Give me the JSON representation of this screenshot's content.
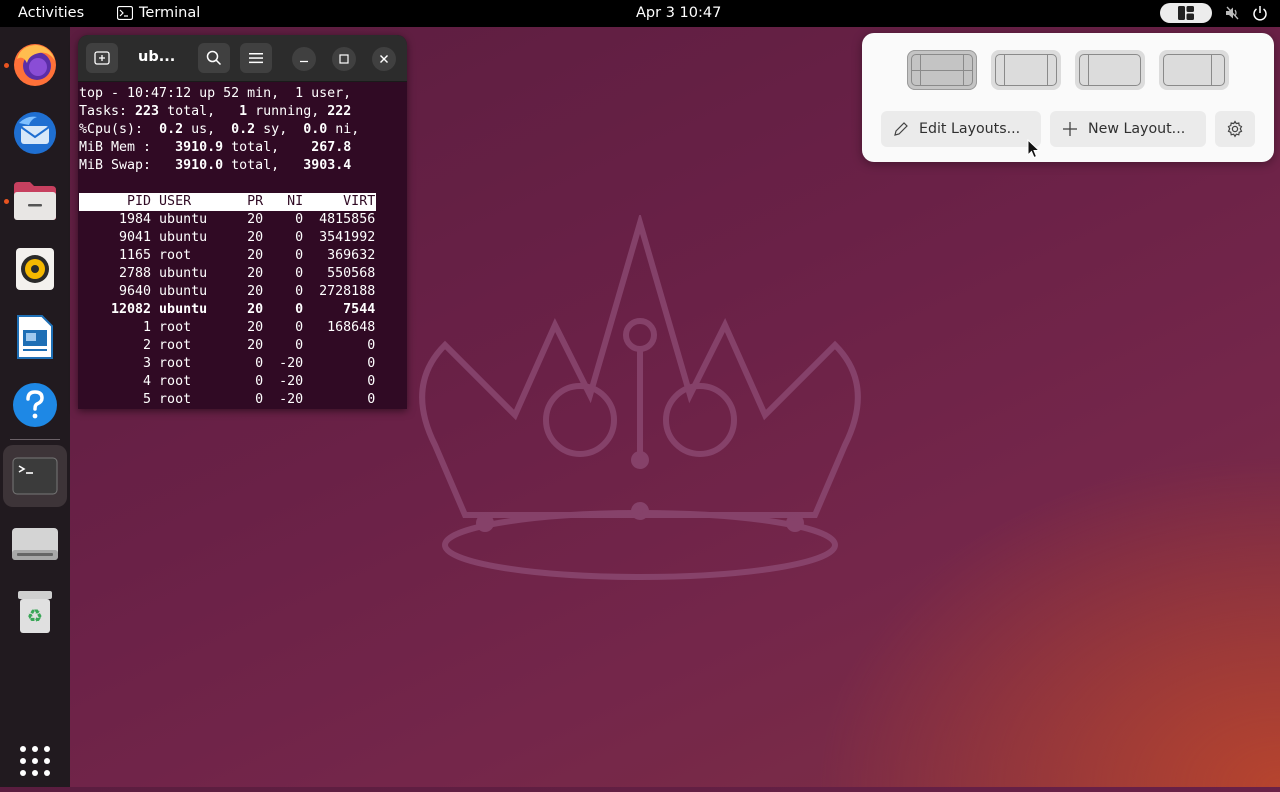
{
  "topbar": {
    "activities": "Activities",
    "app_name": "Terminal",
    "clock": "Apr 3  10:47"
  },
  "dock": {
    "items": [
      "firefox",
      "thunderbird",
      "files",
      "rhythmbox",
      "libreoffice-writer",
      "help",
      "terminal",
      "drive",
      "trash"
    ],
    "show_apps_icon": "grid-icon"
  },
  "terminal": {
    "title": "ub...",
    "summary": [
      "top - 10:47:12 up 52 min,  1 user,",
      "Tasks: 223 total,   1 running, 222",
      "%Cpu(s):  0.2 us,  0.2 sy,  0.0 ni,",
      "MiB Mem :   3910.9 total,    267.8",
      "MiB Swap:   3910.0 total,   3903.4"
    ],
    "columns": [
      "PID",
      "USER",
      "PR",
      "NI",
      "VIRT"
    ],
    "processes": [
      {
        "pid": "1984",
        "user": "ubuntu",
        "pr": "20",
        "ni": "0",
        "virt": "4815856",
        "bold": false
      },
      {
        "pid": "9041",
        "user": "ubuntu",
        "pr": "20",
        "ni": "0",
        "virt": "3541992",
        "bold": false
      },
      {
        "pid": "1165",
        "user": "root",
        "pr": "20",
        "ni": "0",
        "virt": "369632",
        "bold": false
      },
      {
        "pid": "2788",
        "user": "ubuntu",
        "pr": "20",
        "ni": "0",
        "virt": "550568",
        "bold": false
      },
      {
        "pid": "9640",
        "user": "ubuntu",
        "pr": "20",
        "ni": "0",
        "virt": "2728188",
        "bold": false
      },
      {
        "pid": "12082",
        "user": "ubuntu",
        "pr": "20",
        "ni": "0",
        "virt": "7544",
        "bold": true
      },
      {
        "pid": "1",
        "user": "root",
        "pr": "20",
        "ni": "0",
        "virt": "168648",
        "bold": false
      },
      {
        "pid": "2",
        "user": "root",
        "pr": "20",
        "ni": "0",
        "virt": "0",
        "bold": false
      },
      {
        "pid": "3",
        "user": "root",
        "pr": "0",
        "ni": "-20",
        "virt": "0",
        "bold": false
      },
      {
        "pid": "4",
        "user": "root",
        "pr": "0",
        "ni": "-20",
        "virt": "0",
        "bold": false
      },
      {
        "pid": "5",
        "user": "root",
        "pr": "0",
        "ni": "-20",
        "virt": "0",
        "bold": false
      }
    ]
  },
  "layout_popup": {
    "layouts": [
      "layout-1",
      "layout-2",
      "layout-3",
      "layout-4"
    ],
    "selected_index": 0,
    "edit_label": "Edit Layouts...",
    "new_label": "New Layout..."
  },
  "colors": {
    "accent": "#e95420",
    "terminal_bg": "#300a24"
  }
}
